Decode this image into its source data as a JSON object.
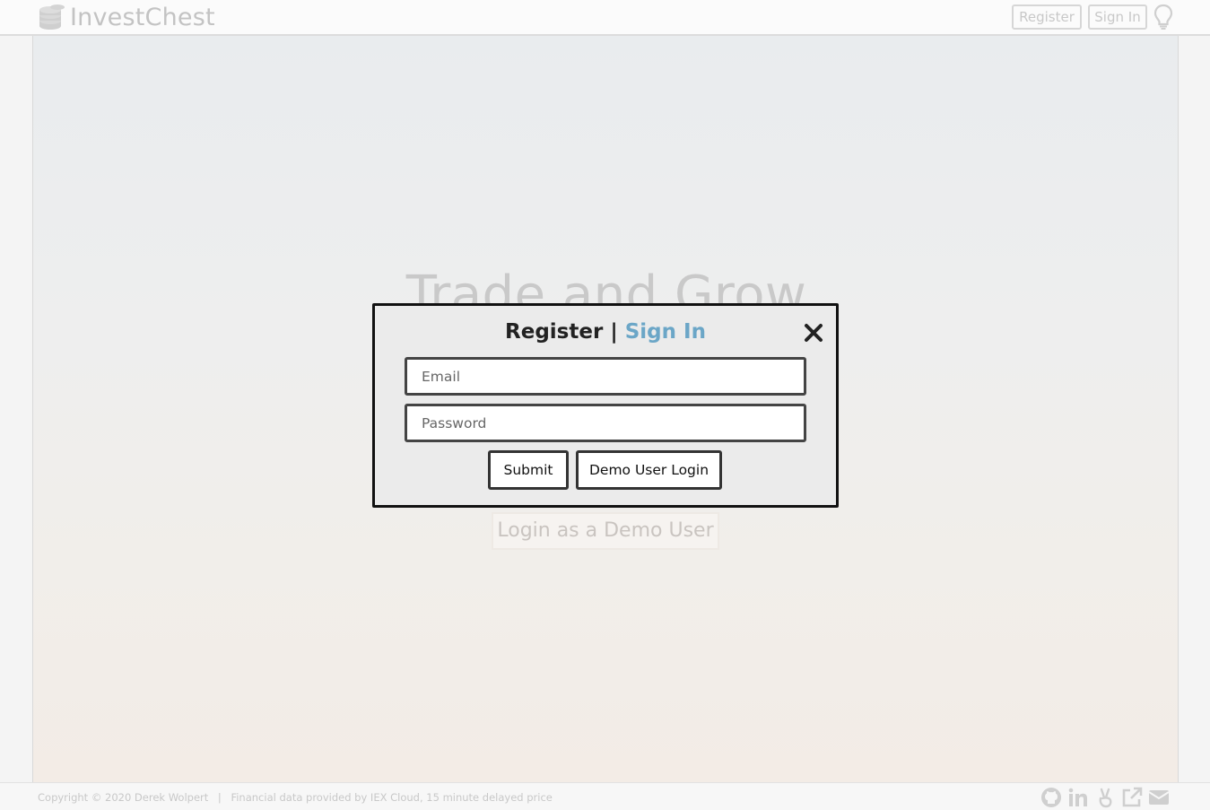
{
  "header": {
    "logo_text": "InvestChest",
    "register_label": "Register",
    "signin_label": "Sign In",
    "icons": [
      "coins-icon",
      "lightbulb-icon"
    ]
  },
  "hero": {
    "title": "Trade and Grow",
    "demo_button": "Login as a Demo User"
  },
  "modal": {
    "title_register": "Register",
    "title_separator": " | ",
    "title_signin": "Sign In",
    "email_placeholder": "Email",
    "email_value": "",
    "password_placeholder": "Password",
    "password_value": "",
    "submit_label": "Submit",
    "demo_label": "Demo User Login",
    "accent_color": "#6ba6c7"
  },
  "footer": {
    "copyright": "Copyright © 2020 Derek Wolpert",
    "separator": "|",
    "data_credit": "Financial data provided by IEX Cloud, 15 minute delayed price",
    "icons": [
      "github-icon",
      "linkedin-icon",
      "angellist-icon",
      "external-link-icon",
      "mail-icon"
    ]
  }
}
